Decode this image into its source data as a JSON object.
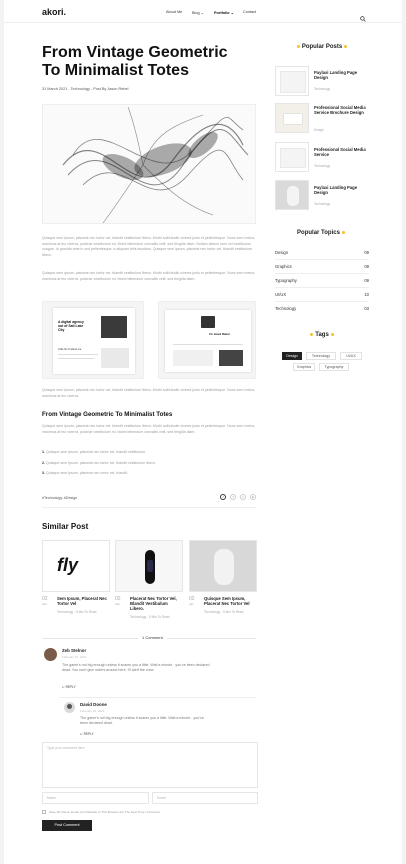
{
  "header": {
    "logo": "akori.",
    "nav": [
      "About Me",
      "Blog",
      "Portfolio",
      "Contact"
    ]
  },
  "post": {
    "title_line1": "From Vintage Geometric",
    "title_line2": "To Minimalist Totes",
    "meta": "31 March 2021 - Technology - Post By Jason Rebel",
    "para1": "Quisque sem ipsum, placerat nec tortor vel, blandit vestibulum libero. Morbi sollicitudin viverra justo et pellentesque. Nunc sem metus, maximus at leo viverra, pulvinar vestibulum mi. Morbi bibendum convallis velit, sed fringilla diam. Nullam dictum sem vel vestibulum congue. In gravida ante in orci pellentesque, a aliquam felis faucibus. Quisque sem ipsum, placerat nec tortor vel, blandit vestibulum libero.",
    "para2": "Quisque sem ipsum, placerat nec tortor vel, blandit vestibulum libero. Morbi sollicitudin viverra justo et pellentesque. Nunc sem metus, maximus at leo viverra, pulvinar vestibulum mi. Morbi bibendum convallis velit, sed fringilla diam.",
    "para3": "Quisque sem ipsum, placerat nec tortor vel, blandit vestibulum libero. Morbi sollicitudin viverra justo et pellentesque. Nunc sem metus, maximus at leo viverra.",
    "subheading": "From Vintage Geometric To Minimalist Totes",
    "para4": "Quisque sem ipsum, placerat nec tortor vel, blandit vestibulum libero. Morbi sollicitudin viverra justo et pellentesque. Nunc sem metus, maximus at leo viverra, pulvinar vestibulum mi. Morbi bibendum convallis velit, sed fringilla diam.",
    "list": [
      "Quisque sem ipsum, placerat nec tortor vel, blandit vestibulum.",
      "Quisque sem ipsum, placerat nec tortor vel, blandit vestibulum libero.",
      "Quisque sem ipsum, placerat nec tortor vel, blandit."
    ],
    "mock1_heading": "A digital agency out of Salt Lake City",
    "mock1_sub": "Little bit of about me",
    "mock2_heading": "I'm Jared Rebel",
    "post_tags": "#Technology, #Design"
  },
  "sidebar": {
    "popular_posts_title": "Popular Posts",
    "popular_posts": [
      {
        "title": "Paylaxi Landing Page Design",
        "category": "Technology"
      },
      {
        "title": "Professional Social Media Service Brochure Design",
        "category": "Design"
      },
      {
        "title": "Professional Social Media Service",
        "category": "Technology"
      },
      {
        "title": "Paylaxi Landing Page Design",
        "category": "Technology"
      }
    ],
    "popular_topics_title": "Popular Topics",
    "topics": [
      {
        "name": "Design",
        "count": "09"
      },
      {
        "name": "Graphics",
        "count": "09"
      },
      {
        "name": "Typography",
        "count": "09"
      },
      {
        "name": "UI/UX",
        "count": "10"
      },
      {
        "name": "Technology",
        "count": "03"
      }
    ],
    "tags_title": "Tags",
    "tags": [
      "Design",
      "Technology",
      "UI/UX",
      "Graphics",
      "Typography"
    ]
  },
  "similar": {
    "title": "Similar Post",
    "cards": [
      {
        "day": "02",
        "month": "Jan",
        "title": "Sem Ipsum, Placerat Nec Tortor Vel",
        "meta": "Technology - 5 Min To Read",
        "logo": "fly"
      },
      {
        "day": "02",
        "month": "Jan",
        "title": "Placerat Nec Tortor Vel, Blandit Vestibulum Libero.",
        "meta": "Technology - 5 Min To Read"
      },
      {
        "day": "02",
        "month": "Jan",
        "title": "Quisque Sem Ipsum, Placerat Nec Tortor Vel",
        "meta": "Technology - 5 Min To Read"
      }
    ]
  },
  "comments": {
    "count_label": "1 Comment",
    "items": [
      {
        "name": "Zeb Stelnor",
        "date": "February 10, 2021",
        "text": "The game's not big enough unless it scares you a little. Wait a minute - you've been declared dead. You can't give orders around here. I'll alert the crew.",
        "reply": "REPLY"
      },
      {
        "name": "David Doone",
        "date": "February 10, 2021",
        "text": "The game's not big enough unless it scares you a little. Wait a minute - you've been declared dead.",
        "reply": "REPLY"
      }
    ],
    "form": {
      "message_placeholder": "Type your comment here",
      "name_placeholder": "Name",
      "email_placeholder": "Email",
      "save_label": "Save My Name, Email, And Website In This Browser For The Next Time I Comment.",
      "submit": "Post Comment"
    }
  }
}
